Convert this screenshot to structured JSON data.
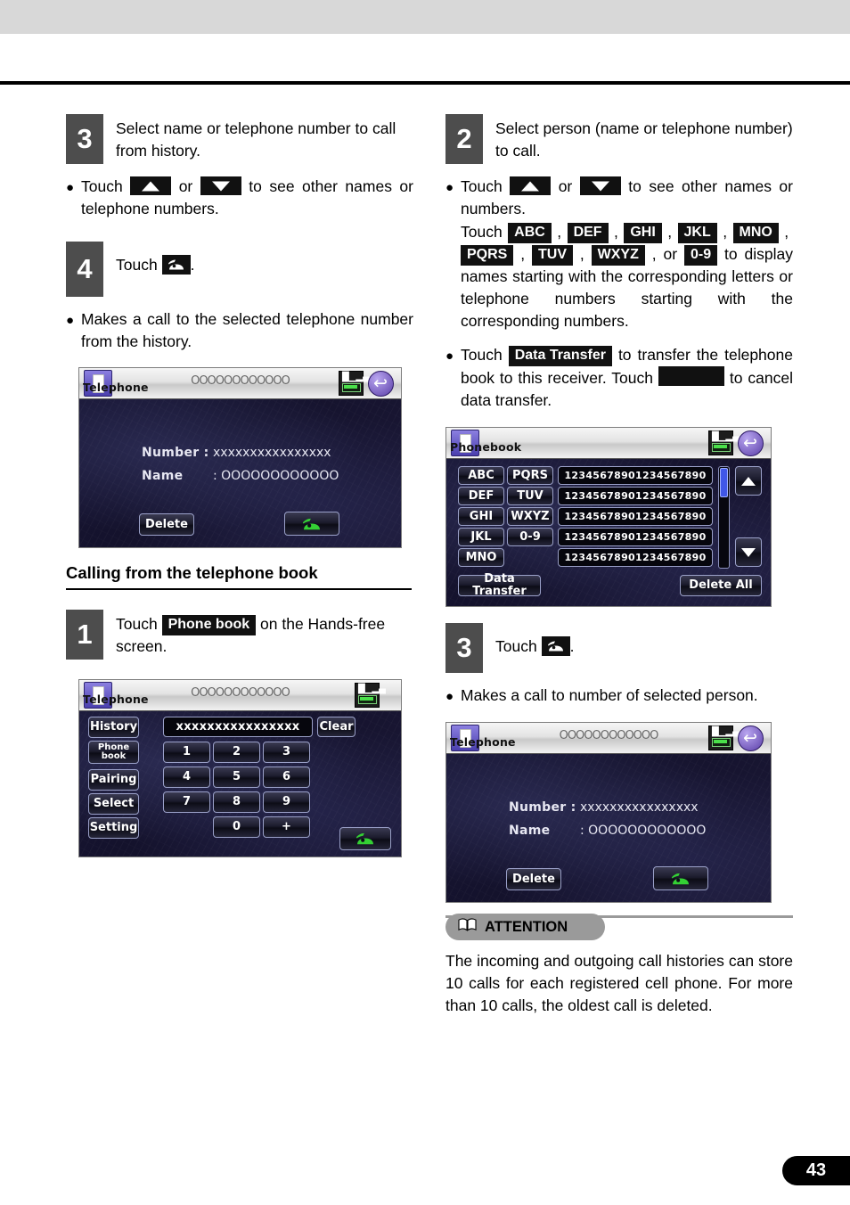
{
  "page": {
    "number": "43"
  },
  "left_column": {
    "step3": {
      "badge": "3",
      "text": "Select name or telephone number to call from history.",
      "bullet1_pre": "Touch",
      "bullet1_mid": "or",
      "bullet1_post": "to see other names or telephone numbers."
    },
    "step4": {
      "badge": "4",
      "text_pre": "Touch",
      "text_post": ".",
      "bullet1": "Makes a call to the selected telephone number from the history."
    },
    "telephone_screen": {
      "title": "Telephone",
      "header_placeholder": "OOOOOOOOOOOO",
      "number_label": "Number :",
      "number_value": "xxxxxxxxxxxxxxxx",
      "name_label": "Name",
      "name_value": ": OOOOOOOOOOOO",
      "delete_label": "Delete",
      "call_icon": "phone-call-icon"
    },
    "section_heading": "Calling from the telephone book",
    "step1": {
      "badge": "1",
      "text_pre": "Touch",
      "chip": "Phone book",
      "text_post": "on the Hands-free screen."
    },
    "keypad_screen": {
      "title": "Telephone",
      "header_placeholder": "OOOOOOOOOOOO",
      "display_value": "xxxxxxxxxxxxxxxx",
      "clear_label": "Clear",
      "side_buttons": [
        "History",
        "Phone\nbook",
        "Pairing",
        "Select",
        "Setting"
      ],
      "keys": [
        "1",
        "2",
        "3",
        "4",
        "5",
        "6",
        "7",
        "8",
        "9",
        "0",
        "+"
      ],
      "call_icon": "phone-call-icon"
    }
  },
  "right_column": {
    "step2": {
      "badge": "2",
      "text": "Select person (name or telephone number) to call.",
      "bullet1_pre": "Touch",
      "bullet1_mid": "or",
      "bullet1_post": "to see other names or numbers.",
      "bullet1_sub_pre": "Touch",
      "letter_chips": [
        "ABC",
        "DEF",
        "GHI",
        "JKL",
        "MNO",
        "PQRS",
        "TUV",
        "WXYZ",
        "0-9"
      ],
      "bullet1_sub_post": "to display names starting with the corresponding letters or telephone numbers starting with the corresponding numbers.",
      "bullet2_pre": "Touch",
      "bullet2_chip": "Data Transfer",
      "bullet2_mid": "to transfer the telephone book to this receiver. Touch",
      "bullet2_post": "to cancel data transfer."
    },
    "phonebook_screen": {
      "title": "Phonebook",
      "letter_keys": [
        "ABC",
        "PQRS",
        "DEF",
        "TUV",
        "GHI",
        "WXYZ",
        "JKL",
        "0-9",
        "MNO"
      ],
      "entries": [
        "12345678901234567890",
        "12345678901234567890",
        "12345678901234567890",
        "12345678901234567890",
        "12345678901234567890"
      ],
      "data_transfer_label": "Data Transfer",
      "delete_all_label": "Delete All",
      "scroll_up_icon": "triangle-up-icon",
      "scroll_down_icon": "triangle-down-icon"
    },
    "step3": {
      "badge": "3",
      "text_pre": "Touch",
      "text_post": ".",
      "bullet1": "Makes a call to number of selected person."
    },
    "telephone_screen": {
      "title": "Telephone",
      "header_placeholder": "OOOOOOOOOOOO",
      "number_label": "Number :",
      "number_value": "xxxxxxxxxxxxxxxx",
      "name_label": "Name",
      "name_value": ": OOOOOOOOOOOO",
      "delete_label": "Delete",
      "call_icon": "phone-call-icon"
    },
    "attention": {
      "label": "ATTENTION",
      "icon": "open-book-icon",
      "body": "The incoming and outgoing call histories can store 10 calls for each registered cell phone. For more than 10 calls, the oldest call is deleted."
    }
  }
}
